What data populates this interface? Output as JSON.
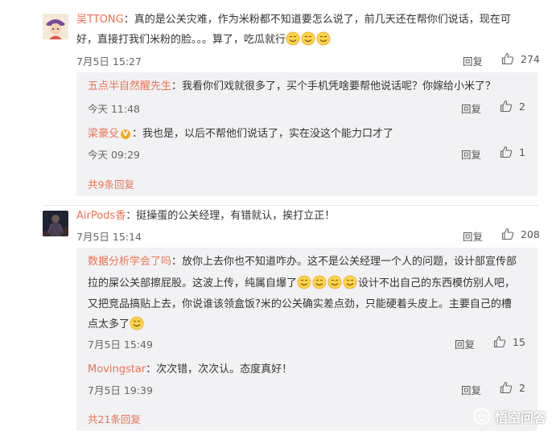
{
  "comments": [
    {
      "username": "吴TTONG",
      "sep": "：",
      "text_line1": "真的是公关灾难，作为米粉都不知道要怎么说了，前几天还在帮你们说话，现在可",
      "text_line2": "好，直接打我们米粉的脸。。。算了，吃瓜就行",
      "time": "7月5日 15:27",
      "reply_label": "回复",
      "likes": "274",
      "replies": [
        {
          "username": "五点半自然醒先生",
          "sep": "：",
          "text": "我看你们戏就很多了，买个手机凭啥要帮他说话呢？你嫁给小米了？",
          "time": "今天 11:48",
          "reply_label": "回复",
          "likes": "2"
        },
        {
          "username": "梁豪殳",
          "badge": "V",
          "sep": "：",
          "text": "我也是，以后不帮他们说话了，实在没这个能力口才了",
          "time": "今天 09:29",
          "reply_label": "回复",
          "likes": "1"
        }
      ],
      "more_replies": "共9条回复"
    },
    {
      "username": "AirPods香",
      "sep": "：",
      "text_line1": "挺操蛋的公关经理，有错就认，挨打立正！",
      "time": "7月5日 15:14",
      "reply_label": "回复",
      "likes": "208",
      "replies": [
        {
          "username": "数据分析学会了吗",
          "sep": "：",
          "line1": "放你上去你也不知道咋办。这不是公关经理一个人的问题，设计部宣传部",
          "line2a": "拉的屎公关部擦屁股。这波上传，纯属自爆了",
          "line2b": "设计不出自己的东西模仿别人吧，",
          "line3": "又把竞品搞贴上去，你说谁该领盒饭?米的公关确实差点劲，只能硬着头皮上。主要自己的槽",
          "line4": "点太多了",
          "time": "7月5日 15:49",
          "reply_label": "回复",
          "likes": "15"
        },
        {
          "username": "Movingstar",
          "sep": "：",
          "text": "次次错，次次认。态度真好！",
          "time": "7月5日 19:39",
          "reply_label": "回复",
          "likes": "2"
        }
      ],
      "more_replies": "共21条回复"
    }
  ],
  "watermark": "悟空问答",
  "icons": {
    "like": "thumbs-up-icon",
    "emoji": "smile-emoji-icon",
    "logo": "wukong-logo-icon"
  },
  "colors": {
    "username": "#eb7350",
    "reply_bg": "#f2f2f5",
    "text": "#333333",
    "meta": "#666666"
  }
}
